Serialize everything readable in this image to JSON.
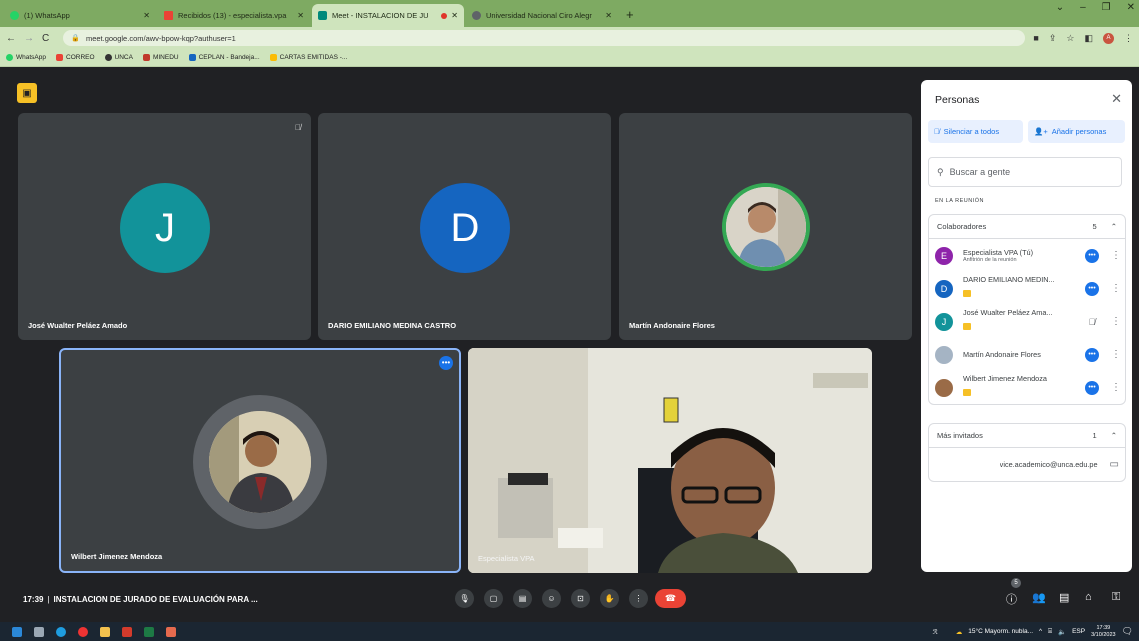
{
  "browser": {
    "tabs": [
      {
        "title": "(1) WhatsApp",
        "color": "#25d366"
      },
      {
        "title": "Recibidos (13) - especialista.vpa",
        "color": "#ea4335"
      },
      {
        "title": "Meet - INSTALACION DE JU",
        "color": "#00897b",
        "active": true
      },
      {
        "title": "Universidad Nacional Ciro Alegr",
        "color": "#5f6368"
      }
    ],
    "url": "meet.google.com/awv-bpow-kqp?authuser=1",
    "profile_initial": "A",
    "bookmarks": [
      {
        "label": "WhatsApp",
        "color": "#25d366"
      },
      {
        "label": "CORREO",
        "color": "#ea4335"
      },
      {
        "label": "UNCA",
        "color": "#333333"
      },
      {
        "label": "MINEDU",
        "color": "#c0392b"
      },
      {
        "label": "CEPLAN - Bandeja...",
        "color": "#1565c0"
      },
      {
        "label": "CARTAS EMITIDAS -...",
        "color": "#fbbc04"
      }
    ]
  },
  "tiles": {
    "t1": {
      "name": "José Wualter Peláez Amado",
      "initial": "J",
      "color": "#12939a"
    },
    "t2": {
      "name": "DARIO EMILIANO MEDINA CASTRO",
      "initial": "D",
      "color": "#1565c0"
    },
    "t3": {
      "name": "Martín Andonaire Flores"
    },
    "t4": {
      "name": "Wilbert Jimenez Mendoza"
    },
    "t5": {
      "name": "Especialista VPA"
    }
  },
  "panel": {
    "title": "Personas",
    "mute_all": "Silenciar a todos",
    "add_people": "Añadir personas",
    "search_placeholder": "Buscar a gente",
    "in_meeting": "EN LA REUNIÓN",
    "collaborators_label": "Colaboradores",
    "collaborators_count": "5",
    "participants": [
      {
        "name": "Especialista VPA (Tú)",
        "sub": "Anfitrión de la reunión",
        "initial": "E",
        "color": "#8e24aa"
      },
      {
        "name": "DARIO EMILIANO MEDIN...",
        "initial": "D",
        "color": "#1565c0"
      },
      {
        "name": "José Wualter Peláez Ama...",
        "initial": "J",
        "color": "#12939a"
      },
      {
        "name": "Martín Andonaire Flores"
      },
      {
        "name": "Wilbert Jimenez Mendoza"
      }
    ],
    "more_guests_label": "Más invitados",
    "more_guests_count": "1",
    "guest_email": "vice.academico@unca.edu.pe"
  },
  "bottombar": {
    "time": "17:39",
    "meeting_title": "INSTALACION DE JURADO DE EVALUACIÓN PARA ...",
    "participants_badge": "5"
  },
  "taskbar": {
    "weather": "15°C  Mayorm. nubla...",
    "lang": "ESP",
    "time": "17:39",
    "date": "3/10/2023"
  }
}
